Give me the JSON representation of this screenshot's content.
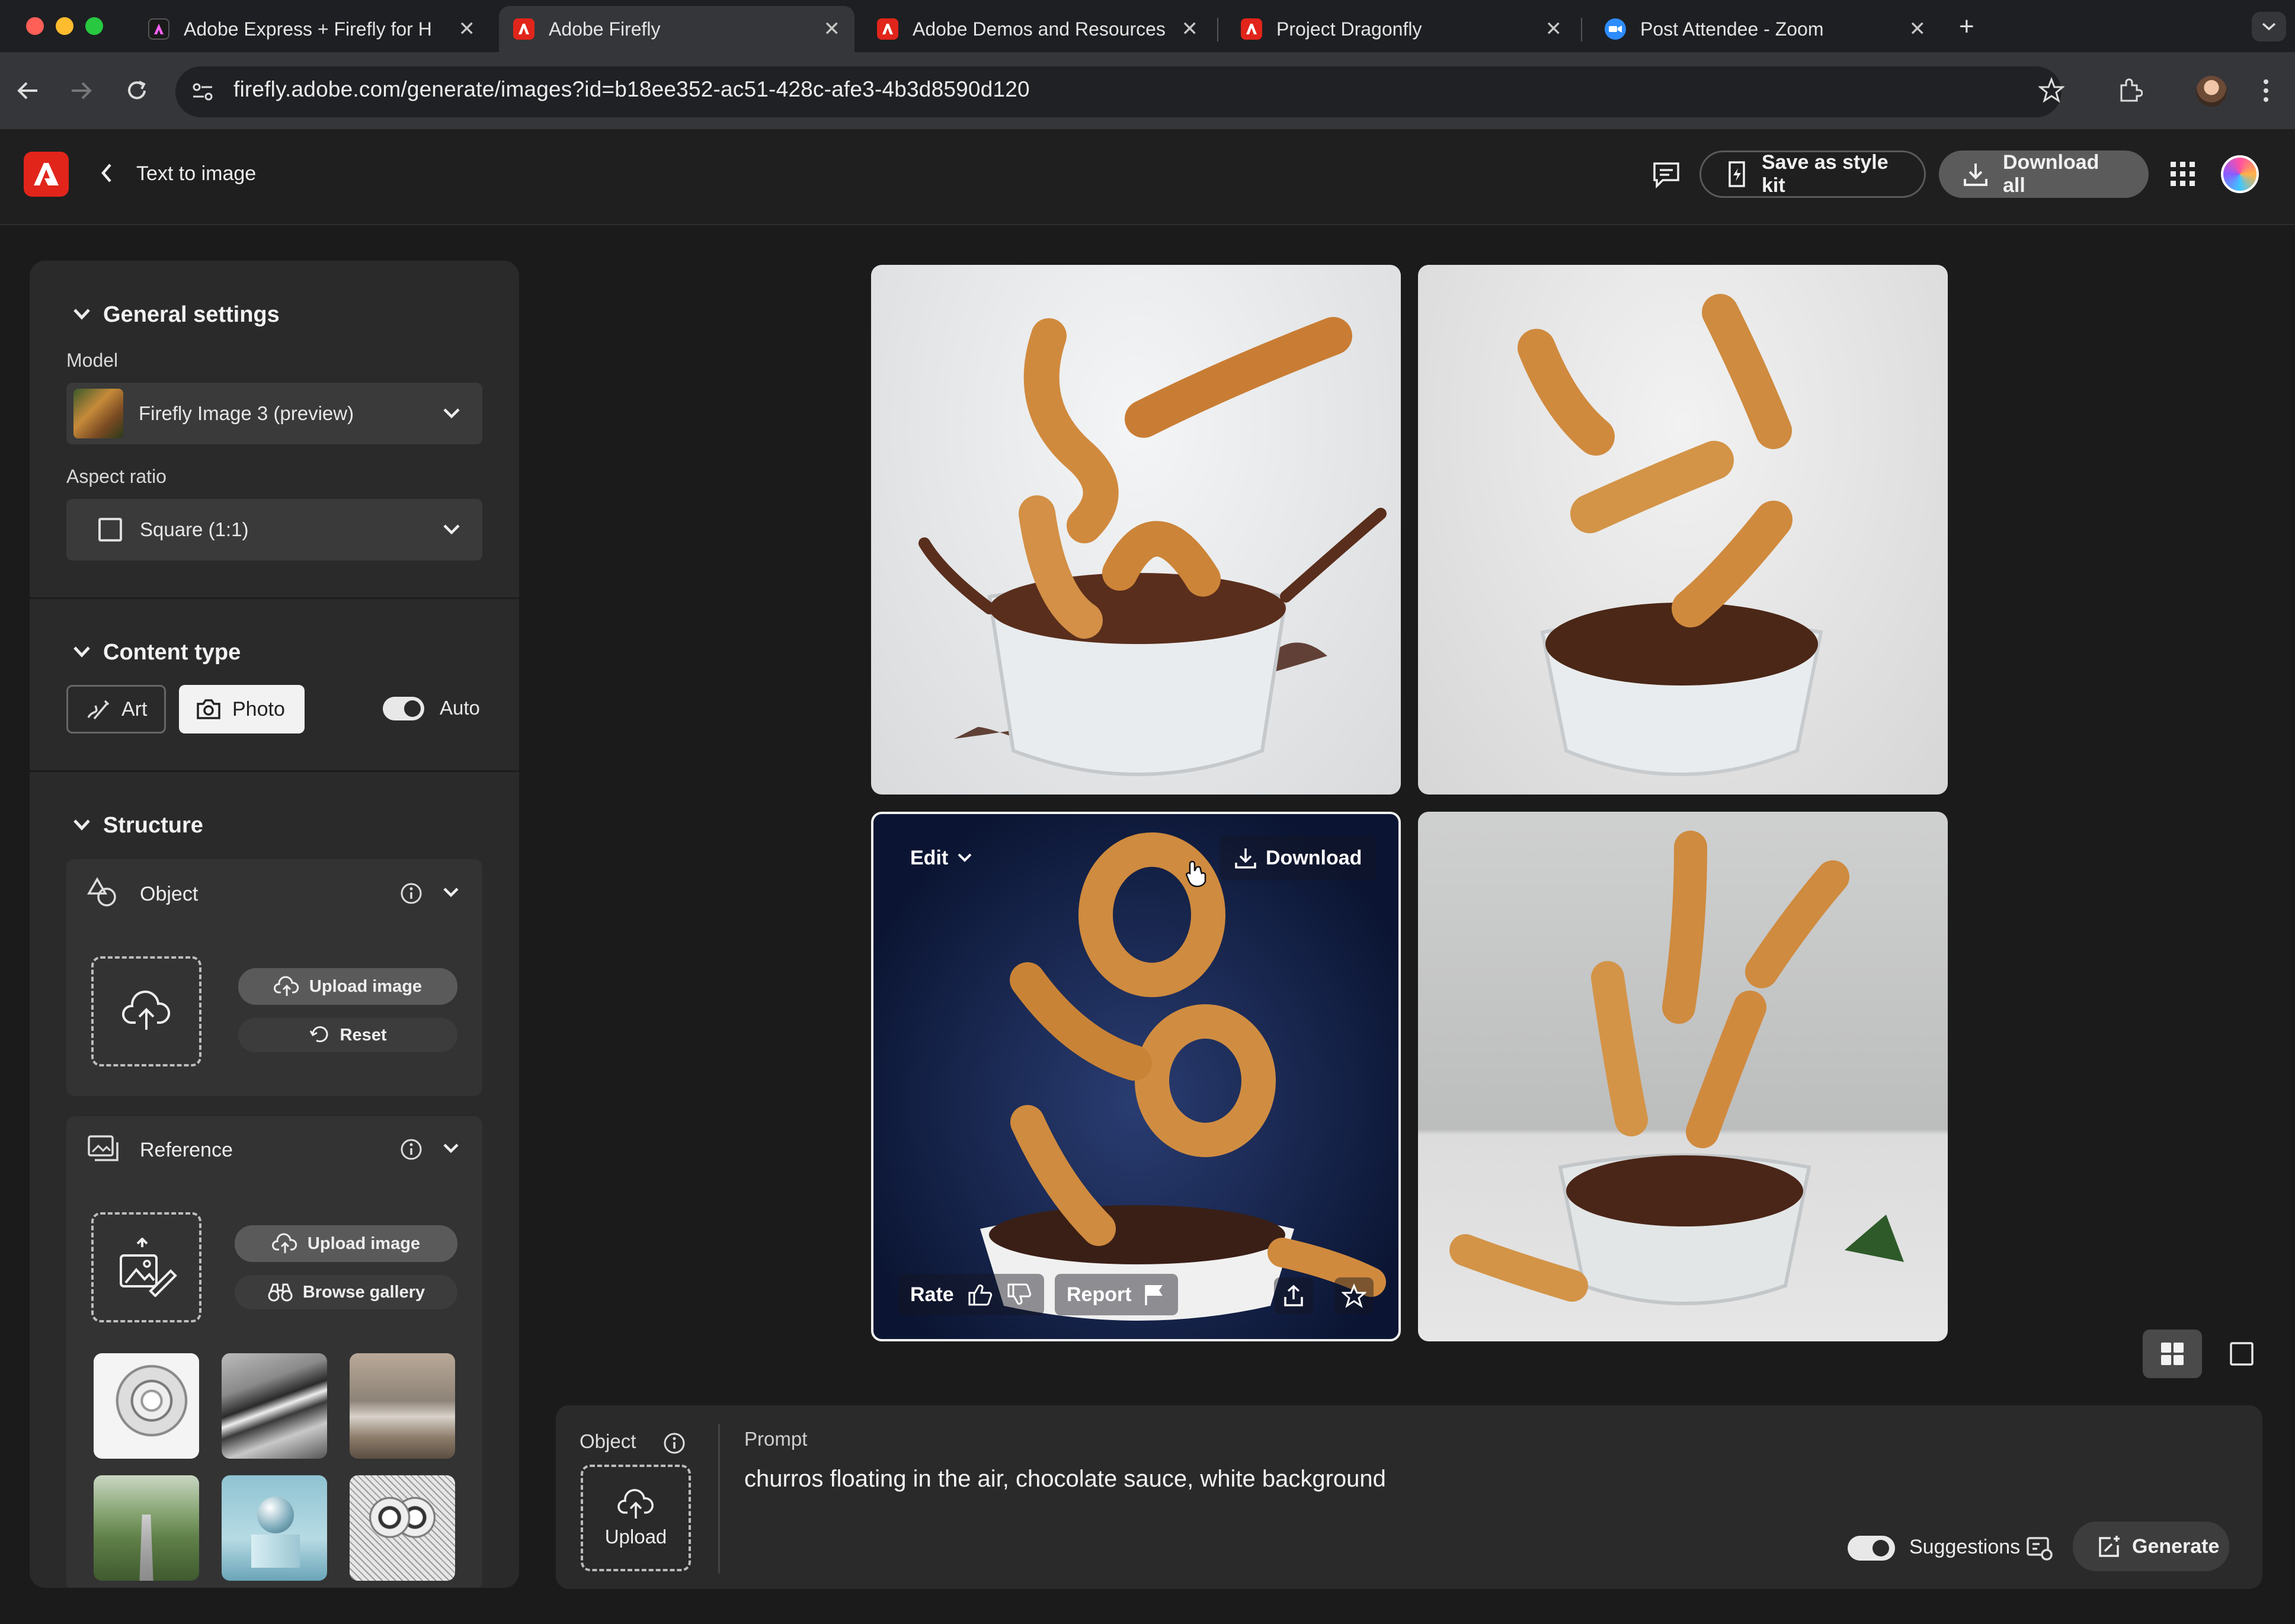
{
  "browser": {
    "tabs": [
      {
        "title": "Adobe Express + Firefly for H",
        "icon": "adobe-express-icon",
        "color": "#1a1a1a"
      },
      {
        "title": "Adobe Firefly",
        "icon": "adobe-icon",
        "color": "#e1251b"
      },
      {
        "title": "Adobe Demos and Resources",
        "icon": "adobe-icon",
        "color": "#e1251b"
      },
      {
        "title": "Project Dragonfly",
        "icon": "adobe-icon",
        "color": "#e1251b"
      },
      {
        "title": "Post Attendee - Zoom",
        "icon": "zoom-icon",
        "color": "#2d8cff"
      }
    ],
    "url": "firefly.adobe.com/generate/images?id=b18ee352-ac51-428c-afe3-4b3d8590d120"
  },
  "header": {
    "back_label": "Text to image",
    "save_style_kit": "Save as style kit",
    "download_all": "Download all"
  },
  "sidebar": {
    "general": {
      "title": "General settings",
      "model_label": "Model",
      "model_value": "Firefly Image 3 (preview)",
      "aspect_label": "Aspect ratio",
      "aspect_value": "Square (1:1)"
    },
    "content_type": {
      "title": "Content type",
      "art": "Art",
      "photo": "Photo",
      "selected": "Photo",
      "auto": "Auto",
      "auto_on": true
    },
    "structure": {
      "title": "Structure",
      "object_label": "Object",
      "upload_image": "Upload image",
      "reset": "Reset"
    },
    "reference": {
      "label": "Reference",
      "upload_image": "Upload image",
      "browse_gallery": "Browse gallery"
    }
  },
  "grid": {
    "hover": {
      "edit": "Edit",
      "download": "Download",
      "rate": "Rate",
      "report": "Report"
    }
  },
  "prompt": {
    "object_label": "Object",
    "upload": "Upload",
    "prompt_label": "Prompt",
    "prompt_text": "churros floating in the air, chocolate sauce, white background",
    "suggestions": "Suggestions",
    "suggestions_on": true,
    "generate": "Generate"
  },
  "colors": {
    "adobe_red": "#e1251b",
    "panel": "#2a2a2a",
    "background": "#1b1b1b"
  }
}
